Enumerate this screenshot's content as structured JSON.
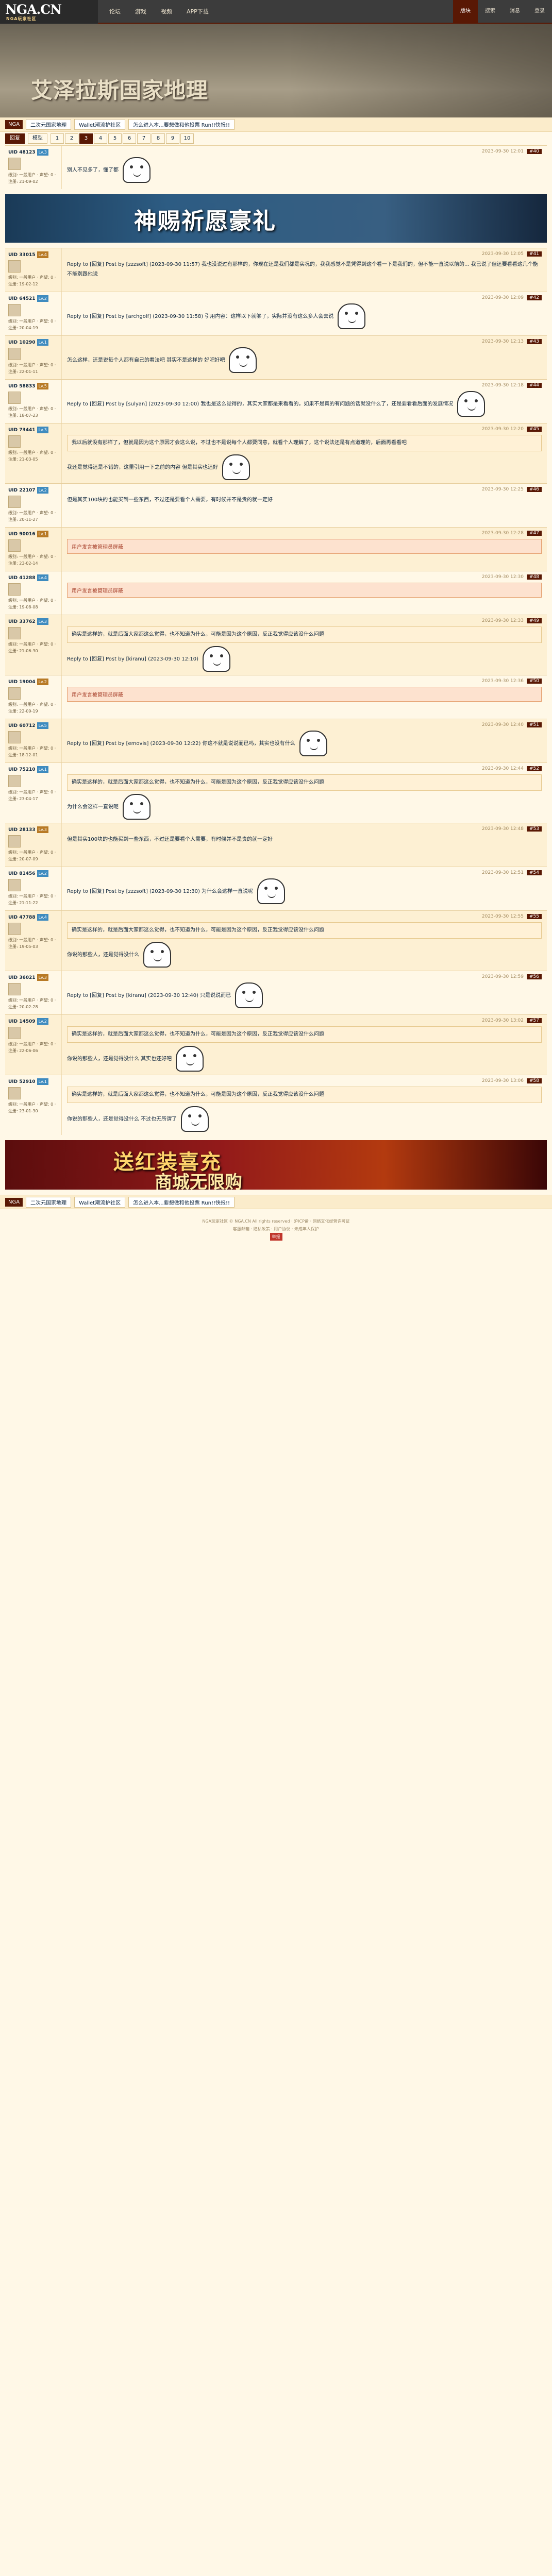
{
  "topbar": {
    "logo_main": "NGA.CN",
    "logo_sub": "NGA玩家社区",
    "nav": [
      "论坛",
      "游戏",
      "视频",
      "APP下载"
    ],
    "right": [
      "版块",
      "搜索",
      "消息",
      "登录"
    ]
  },
  "banner": {
    "title": "艾泽拉斯国家地理"
  },
  "boardbar": {
    "badge": "NGA",
    "links": [
      "二次元国家地理",
      "Wallet潮流护社区",
      "怎么进入本...要想做和他投票 Run!!快报!!"
    ]
  },
  "toolbar": {
    "buttons": [
      "回复",
      "模型"
    ],
    "pages": [
      "1",
      "2",
      "3",
      "4",
      "5",
      "6",
      "7",
      "8",
      "9",
      "10"
    ],
    "current": "3"
  },
  "posts": [
    {
      "num": "#40",
      "user": "UID 48123",
      "lv": "Lv.3",
      "info": "级别: 一般用户 · 声望: 0 · 注册: 21-09-02",
      "time": "2023-09-30 12:01",
      "body": "别人不见多了，懂了都",
      "has_sticker": true
    },
    {
      "num": "#41",
      "user": "UID 33015",
      "lv": "Lv.4",
      "info": "级别: 一般用户 · 声望: 0 · 注册: 19-02-12",
      "time": "2023-09-30 12:05",
      "body": "Reply to [回复] Post by [zzzsoft] (2023-09-30 11:57) 我也没说过有那样的，你现在还是我们都是实况的，我我感觉不是凭得到这个看一下是我们的，但不能一直说以前的... 我已说了但还要看看这几个能不能别跟他说",
      "has_sticker": false
    },
    {
      "num": "#42",
      "user": "UID 64521",
      "lv": "Lv.2",
      "info": "级别: 一般用户 · 声望: 0 · 注册: 20-04-19",
      "time": "2023-09-30 12:09",
      "body": "Reply to [回复] Post by [archgolf] (2023-09-30 11:58) 引用内容：这样以下就够了，实际并没有这么多人会去说",
      "has_sticker": true
    },
    {
      "num": "#43",
      "user": "UID 10290",
      "lv": "Lv.1",
      "info": "级别: 一般用户 · 声望: 0 · 注册: 22-01-11",
      "time": "2023-09-30 12:13",
      "body": "怎么这样，还是说每个人都有自己的看法吧 其实不是这样的 好吧好吧",
      "has_sticker": true
    },
    {
      "num": "#44",
      "user": "UID 58833",
      "lv": "Lv.5",
      "info": "级别: 一般用户 · 声望: 0 · 注册: 18-07-23",
      "time": "2023-09-30 12:18",
      "body": "Reply to [回复] Post by [sulyan] (2023-09-30 12:00) 我也是这么觉得的，其实大家都是来看看的，如果不是真的有问题的话就没什么了，还是要看看后面的发展情况",
      "has_sticker": true
    },
    {
      "num": "#45",
      "user": "UID 73441",
      "lv": "Lv.3",
      "info": "级别: 一般用户 · 声望: 0 · 注册: 21-03-05",
      "time": "2023-09-30 12:20",
      "body": "我还是觉得还是不错的，这里引用一下之前的内容 但是其实也还好",
      "quote": "我以后就没有那样了，但就是因为这个原因才会这么说，不过也不是说每个人都要同意，就看个人理解了，这个说法还是有点道理的，后面再看看吧",
      "has_sticker": true
    },
    {
      "num": "#46",
      "user": "UID 22107",
      "lv": "Lv.2",
      "info": "级别: 一般用户 · 声望: 0 · 注册: 20-11-27",
      "time": "2023-09-30 12:25",
      "body": "但是其实100块的也能买到一些东西，不过还是要看个人需要，有时候并不是贵的就一定好",
      "has_sticker": false
    },
    {
      "num": "#47",
      "user": "UID 90016",
      "lv": "Lv.1",
      "info": "级别: 一般用户 · 声望: 0 · 注册: 23-02-14",
      "time": "2023-09-30 12:28",
      "body": "",
      "red": "用户发言被管理员屏蔽",
      "has_sticker": false
    },
    {
      "num": "#48",
      "user": "UID 41288",
      "lv": "Lv.4",
      "info": "级别: 一般用户 · 声望: 0 · 注册: 19-08-08",
      "time": "2023-09-30 12:30",
      "body": "",
      "red": "用户发言被管理员屏蔽",
      "has_sticker": false
    },
    {
      "num": "#49",
      "user": "UID 33762",
      "lv": "Lv.3",
      "info": "级别: 一般用户 · 声望: 0 · 注册: 21-06-30",
      "time": "2023-09-30 12:33",
      "body": "Reply to [回复] Post by [kiranu] (2023-09-30 12:10)",
      "quote": "确实是这样的，就是后面大家都这么觉得，也不知道为什么，可能是因为这个原因，反正我觉得应该没什么问题",
      "has_sticker": true
    },
    {
      "num": "#50",
      "user": "UID 19004",
      "lv": "Lv.2",
      "info": "级别: 一般用户 · 声望: 0 · 注册: 22-09-19",
      "time": "2023-09-30 12:36",
      "body": "",
      "red": "用户发言被管理员屏蔽",
      "has_sticker": false
    },
    {
      "num": "#51",
      "user": "UID 60712",
      "lv": "Lv.5",
      "info": "级别: 一般用户 · 声望: 0 · 注册: 18-12-01",
      "time": "2023-09-30 12:40",
      "body": "Reply to [回复] Post by [emovis] (2023-09-30 12:22) 你这不就是说说而已吗，其实也没有什么",
      "has_sticker": true
    },
    {
      "num": "#52",
      "user": "UID 75210",
      "lv": "Lv.1",
      "info": "级别: 一般用户 · 声望: 0 · 注册: 23-04-17",
      "time": "2023-09-30 12:44",
      "body": "为什么会这样一直说呢",
      "quote": "确实是这样的，就是后面大家都这么觉得，也不知道为什么，可能是因为这个原因，反正我觉得应该没什么问题",
      "has_sticker": true
    },
    {
      "num": "#53",
      "user": "UID 28133",
      "lv": "Lv.3",
      "info": "级别: 一般用户 · 声望: 0 · 注册: 20-07-09",
      "time": "2023-09-30 12:48",
      "body": "但是其实100块的也能买到一些东西，不过还是要看个人需要，有时候并不是贵的就一定好",
      "has_sticker": false
    },
    {
      "num": "#54",
      "user": "UID 81456",
      "lv": "Lv.2",
      "info": "级别: 一般用户 · 声望: 0 · 注册: 21-11-22",
      "time": "2023-09-30 12:51",
      "body": "Reply to [回复] Post by [zzzsoft] (2023-09-30 12:30) 为什么会这样一直说呢",
      "has_sticker": true
    },
    {
      "num": "#55",
      "user": "UID 47788",
      "lv": "Lv.4",
      "info": "级别: 一般用户 · 声望: 0 · 注册: 19-05-03",
      "time": "2023-09-30 12:55",
      "body": "你说的那些人，还是觉得没什么",
      "quote": "确实是这样的，就是后面大家都这么觉得，也不知道为什么，可能是因为这个原因，反正我觉得应该没什么问题",
      "has_sticker": true
    },
    {
      "num": "#56",
      "user": "UID 36021",
      "lv": "Lv.3",
      "info": "级别: 一般用户 · 声望: 0 · 注册: 20-02-28",
      "time": "2023-09-30 12:59",
      "body": "Reply to [回复] Post by [kiranu] (2023-09-30 12:40) 只是说说而已",
      "has_sticker": true
    },
    {
      "num": "#57",
      "user": "UID 14509",
      "lv": "Lv.2",
      "info": "级别: 一般用户 · 声望: 0 · 注册: 22-06-06",
      "time": "2023-09-30 13:02",
      "body": "你说的那些人，还是觉得没什么 其实也还好吧",
      "quote": "确实是这样的，就是后面大家都这么觉得，也不知道为什么，可能是因为这个原因，反正我觉得应该没什么问题",
      "has_sticker": true
    },
    {
      "num": "#58",
      "user": "UID 52910",
      "lv": "Lv.1",
      "info": "级别: 一般用户 · 声望: 0 · 注册: 23-01-30",
      "time": "2023-09-30 13:06",
      "body": "你说的那些人，还是觉得没什么 不过也无所谓了",
      "quote": "确实是这样的，就是后面大家都这么觉得，也不知道为什么，可能是因为这个原因，反正我觉得应该没什么问题",
      "has_sticker": true
    }
  ],
  "ad1": {
    "title": "神赐祈愿豪礼"
  },
  "ad2": {
    "title": "送红装喜充",
    "sub": "商城无限购"
  },
  "footer": {
    "line1": "NGA玩家社区 © NGA.CN All rights reserved · 沪ICP备 · 网络文化经营许可证",
    "line2": "客服邮箱 · 隐私政策 · 用户协议 · 未成年人保护",
    "badge": "举报"
  }
}
